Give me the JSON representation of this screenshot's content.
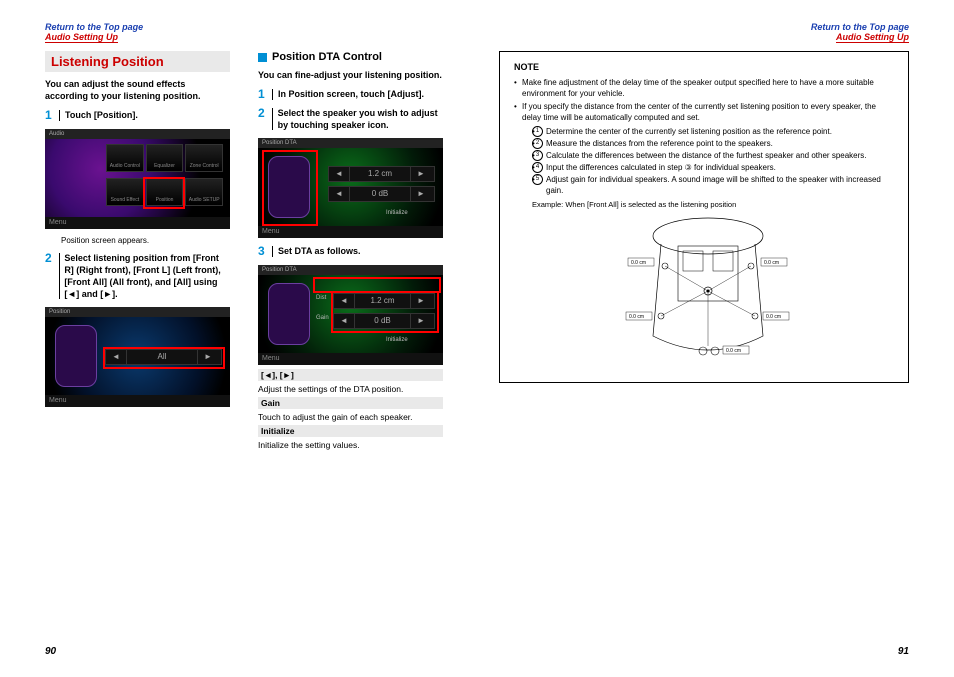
{
  "header": {
    "topLink": "Return to the Top page",
    "subLink": "Audio Setting Up"
  },
  "left": {
    "h1": "Listening Position",
    "intro": "You can adjust the sound effects according to your listening position.",
    "step1": {
      "num": "1",
      "body": "Touch [Position]."
    },
    "shot1": {
      "title": "Audio",
      "menu": "Menu",
      "icons": [
        "Audio Control",
        "Equalizer",
        "Zone Control"
      ],
      "icons2": [
        "Sound Effect",
        "Position",
        "Audio SETUP"
      ]
    },
    "caption1": "Position screen appears.",
    "step2": {
      "num": "2",
      "body": "Select listening position from [Front R] (Right front), [Front L] (Left front), [Front All] (All front), and [All] using [◄] and [►]."
    },
    "shot2": {
      "title": "Position",
      "menu": "Menu",
      "center": "All"
    }
  },
  "mid": {
    "h2": "Position DTA Control",
    "intro": "You can fine-adjust your listening position.",
    "step1": {
      "num": "1",
      "body": "In Position screen, touch [Adjust]."
    },
    "step2": {
      "num": "2",
      "body": "Select the speaker you wish to adjust by touching speaker icon."
    },
    "shot1": {
      "title": "Position DTA",
      "menu": "Menu",
      "dist": "1.2 cm",
      "gain": "0 dB",
      "init": "Initialize"
    },
    "step3": {
      "num": "3",
      "body": "Set DTA as follows."
    },
    "shot2": {
      "title": "Position DTA",
      "menu": "Menu",
      "lblDist": "Dist",
      "dist": "1.2 cm",
      "lblGain": "Gain",
      "gain": "0 dB",
      "init": "Initialize"
    },
    "kv": [
      {
        "h": "[◄], [►]",
        "t": "Adjust the settings of the DTA position."
      },
      {
        "h": "Gain",
        "t": "Touch to adjust the gain of each speaker."
      },
      {
        "h": "Initialize",
        "t": "Initialize the setting values."
      }
    ]
  },
  "note": {
    "title": "NOTE",
    "b1": "Make fine adjustment of the delay time of the speaker output specified here to have a more suitable environment for your vehicle.",
    "b2": "If you specify the distance from the center of the currently set listening position to every speaker, the delay time will be automatically computed and set.",
    "ol": [
      "Determine the center of the currently set listening position as the reference point.",
      "Measure the distances from the reference point to the speakers.",
      "Calculate the differences between the distance of the furthest speaker and other speakers.",
      "Input the differences calculated in step ③ for individual speakers.",
      "Adjust gain for individual speakers. A sound image will be shifted to the speaker with increased gain."
    ],
    "example": "Example: When [Front All] is selected as the listening position",
    "diagLabels": {
      "a": "0.0 cm",
      "b": "0.0 cm",
      "c": "0.0 cm",
      "d": "0.0 cm",
      "e": "0.0 cm",
      "f": "0.0 cm"
    }
  },
  "footer": {
    "left": "90",
    "right": "91"
  }
}
